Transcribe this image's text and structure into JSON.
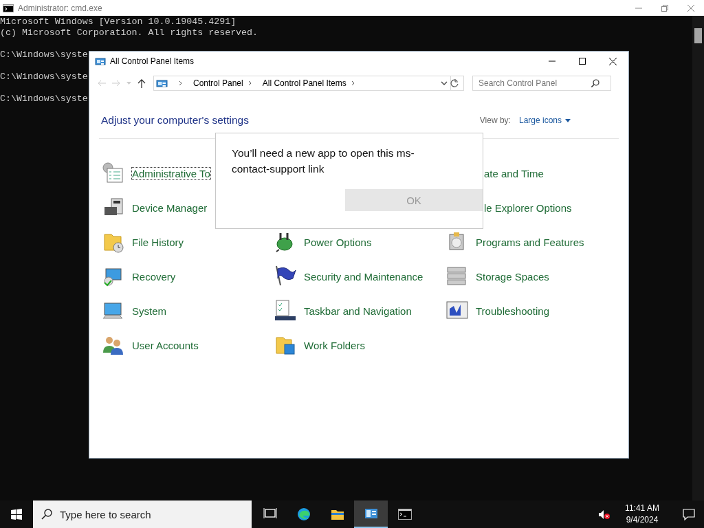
{
  "cmd_window": {
    "title": "Administrator: cmd.exe",
    "output": [
      "Microsoft Windows [Version 10.0.19045.4291]",
      "(c) Microsoft Corporation. All rights reserved."
    ],
    "prompts": [
      "C:\\Windows\\syste",
      "C:\\Windows\\syste",
      "C:\\Windows\\syste"
    ]
  },
  "control_panel": {
    "title": "All Control Panel Items",
    "breadcrumbs": [
      "Control Panel",
      "All Control Panel Items"
    ],
    "search": {
      "placeholder": "Search Control Panel"
    },
    "heading": "Adjust your computer's settings",
    "view_by": {
      "label": "View by:",
      "value": "Large icons"
    },
    "rows": [
      [
        {
          "label": "Administrative To",
          "icon_visible": true,
          "focused": true
        },
        null,
        {
          "label": "ate and Time",
          "icon_visible": false,
          "focused": false
        }
      ],
      [
        {
          "label": "Device Manager",
          "icon_visible": true,
          "focused": false
        },
        null,
        {
          "label": "le Explorer Options",
          "icon_visible": false,
          "focused": false
        }
      ],
      [
        {
          "label": "File History",
          "icon_visible": true,
          "focused": false
        },
        {
          "label": "Power Options",
          "icon_visible": true,
          "focused": false
        },
        {
          "label": "Programs and Features",
          "icon_visible": true,
          "focused": false
        }
      ],
      [
        {
          "label": "Recovery",
          "icon_visible": true,
          "focused": false
        },
        {
          "label": "Security and Maintenance",
          "icon_visible": true,
          "focused": false
        },
        {
          "label": "Storage Spaces",
          "icon_visible": true,
          "focused": false
        }
      ],
      [
        {
          "label": "System",
          "icon_visible": true,
          "focused": false
        },
        {
          "label": "Taskbar and Navigation",
          "icon_visible": true,
          "focused": false
        },
        {
          "label": "Troubleshooting",
          "icon_visible": true,
          "focused": false
        }
      ],
      [
        {
          "label": "User Accounts",
          "icon_visible": true,
          "focused": false
        },
        {
          "label": "Work Folders",
          "icon_visible": true,
          "focused": false
        },
        null
      ]
    ]
  },
  "dialog": {
    "message": "You’ll need a new app to open this ms-contact-support link",
    "button": {
      "label": "OK",
      "disabled": true
    }
  },
  "taskbar": {
    "search": {
      "placeholder": "Type here to search"
    },
    "apps": [
      {
        "selected": false
      },
      {
        "selected": false
      },
      {
        "selected": false
      },
      {
        "selected": true
      },
      {
        "selected": false
      }
    ],
    "clock": {
      "time": "11:41 AM",
      "date": "9/4/2024"
    }
  }
}
